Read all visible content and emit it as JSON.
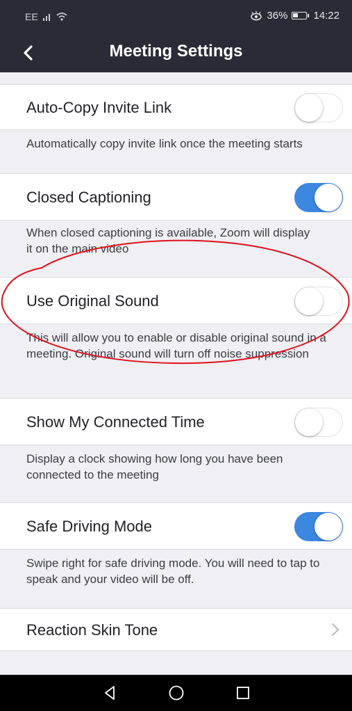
{
  "status_bar": {
    "carrier": "EE",
    "battery_percent": "36%",
    "time": "14:22"
  },
  "header": {
    "title": "Meeting Settings"
  },
  "settings": [
    {
      "label": "Auto-Copy Invite Link",
      "toggle": "off",
      "description": "Automatically copy invite link once the meeting starts"
    },
    {
      "label": "Closed Captioning",
      "toggle": "on",
      "description": "When closed captioning is available, Zoom will display it on the main video"
    },
    {
      "label": "Use Original Sound",
      "toggle": "off",
      "description": "This will allow you to enable or disable original sound in a meeting. Original sound will turn off noise suppression"
    },
    {
      "label": "Show My Connected Time",
      "toggle": "off",
      "description": "Display a clock showing how long you have been connected to the meeting"
    },
    {
      "label": "Safe Driving Mode",
      "toggle": "on",
      "description": "Swipe right for safe driving mode. You will need to tap to speak and your video will be off."
    },
    {
      "label": "Reaction Skin Tone",
      "toggle": null,
      "description": ""
    }
  ],
  "colors": {
    "header_bg": "#2b2b37",
    "toggle_on": "#3c87e0",
    "annotation": "#e0101a",
    "page_bg": "#efeff4"
  },
  "icons": {
    "back": "back-chevron-icon",
    "chevron": "chevron-right-icon",
    "nav_back": "triangle-back-icon",
    "nav_home": "circle-home-icon",
    "nav_recents": "square-recents-icon"
  }
}
